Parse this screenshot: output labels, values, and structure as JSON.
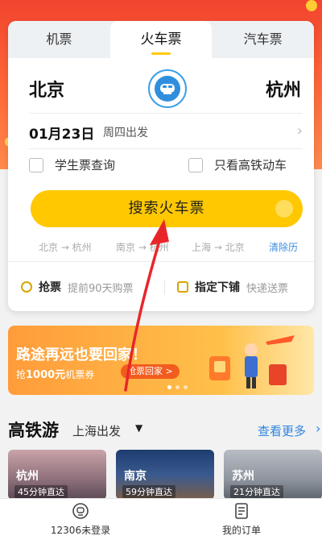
{
  "tabs": [
    {
      "label": "机票",
      "active": false
    },
    {
      "label": "火车票",
      "active": true
    },
    {
      "label": "汽车票",
      "active": false
    }
  ],
  "route": {
    "from": "北京",
    "to": "杭州",
    "swap_icon": "train-swap-icon"
  },
  "date": {
    "main": "01月23日",
    "sub": "周四出发"
  },
  "options": {
    "student": "学生票查询",
    "high_speed_only": "只看高铁动车"
  },
  "search_button": "搜索火车票",
  "history": [
    "北京 → 杭州",
    "南京 → 杭州",
    "上海 → 北京"
  ],
  "history_clear": "清除历",
  "features": {
    "grab": {
      "title": "抢票",
      "desc": "提前90天购票"
    },
    "berth": {
      "title": "指定下铺",
      "desc": "快递送票"
    }
  },
  "promo": {
    "title": "路途再远也要回家！",
    "sub_prefix": "抢",
    "sub_amount": "1000元",
    "sub_suffix": "机票券",
    "button": "抢票回家 >"
  },
  "hsr": {
    "title": "高铁游",
    "from": "上海出发",
    "more": "查看更多",
    "destinations": [
      {
        "name": "杭州",
        "time": "45分钟直达"
      },
      {
        "name": "南京",
        "time": "59分钟直达"
      },
      {
        "name": "苏州",
        "time": "21分钟直达"
      }
    ]
  },
  "bottom_nav": [
    {
      "label": "12306未登录",
      "icon": "train-station-icon"
    },
    {
      "label": "我的订单",
      "icon": "order-list-icon"
    }
  ],
  "colors": {
    "accent": "#ffc800",
    "link": "#2d86e0",
    "banner": "#f2442e",
    "annotation": "#e8262a"
  }
}
